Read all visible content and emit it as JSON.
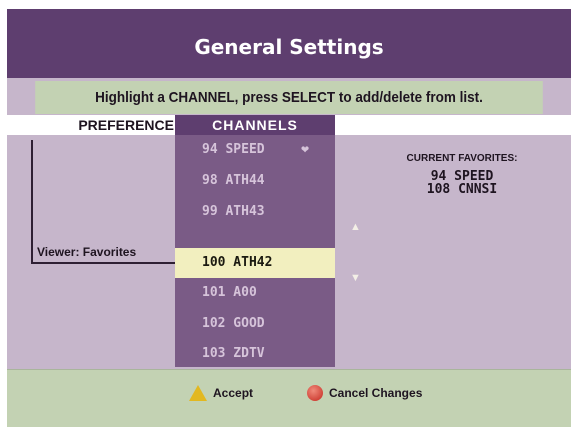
{
  "title": "General Settings",
  "instruction": "Highlight a CHANNEL, press SELECT to add/delete from list.",
  "columns": {
    "preference": "PREFERENCE",
    "channels": "CHANNELS"
  },
  "preference_value": "Viewer: Favorites",
  "channels": [
    {
      "label": "94  SPEED",
      "favorite": true
    },
    {
      "label": "98  ATH44"
    },
    {
      "label": "99  ATH43"
    },
    {
      "label": "100  ATH42",
      "selected": true
    },
    {
      "label": "101  A00"
    },
    {
      "label": "102  GOOD"
    },
    {
      "label": "103  ZDTV"
    }
  ],
  "current_favorites": {
    "heading": "CURRENT FAVORITES:",
    "items": [
      "94  SPEED",
      "108  CNNSI"
    ]
  },
  "footer": {
    "accept": "Accept",
    "cancel": "Cancel Changes"
  },
  "colors": {
    "header": "#5e3e6f",
    "panel": "#c6b6cb",
    "bar": "#c3d2b3",
    "channel_bg": "#7a5b86",
    "selected_bg": "#f2efbf"
  },
  "icons": {
    "accept": "yellow-triangle-a-icon",
    "cancel": "red-circle-icon",
    "favorite": "heart-icon",
    "scroll_up": "up-arrow-icon",
    "scroll_down": "down-arrow-icon"
  }
}
